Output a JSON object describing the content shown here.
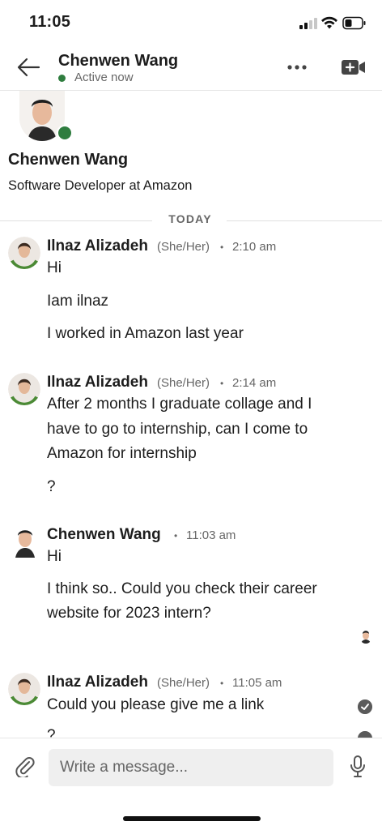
{
  "status_bar": {
    "time": "11:05"
  },
  "header": {
    "name": "Chenwen Wang",
    "presence": "Active now",
    "presence_color": "#2f7d3f"
  },
  "profile": {
    "name": "Chenwen Wang",
    "headline": "Software Developer at Amazon"
  },
  "day_divider": "TODAY",
  "messages": [
    {
      "sender": "Ilnaz Alizadeh",
      "pronouns": "(She/Her)",
      "sep": "•",
      "time": "2:10 am",
      "lines": [
        "Hi",
        "Iam ilnaz",
        "I worked in Amazon last year"
      ]
    },
    {
      "sender": "Ilnaz Alizadeh",
      "pronouns": "(She/Her)",
      "sep": "•",
      "time": "2:14 am",
      "lines": [
        "After 2 months I graduate collage and I",
        "have to go to internship, can I come to",
        "Amazon for internship",
        "?"
      ]
    },
    {
      "sender": "Chenwen Wang",
      "sep": "•",
      "time": "11:03 am",
      "lines": [
        "Hi",
        "I think so.. Could you check their career",
        "website for 2023 intern?"
      ]
    },
    {
      "sender": "Ilnaz Alizadeh",
      "pronouns": "(She/Her)",
      "sep": "•",
      "time": "11:05 am",
      "lines": [
        "Could you please give me a link",
        "?"
      ]
    }
  ],
  "composer": {
    "placeholder": "Write a message..."
  },
  "icons": {
    "back": "arrow-left-icon",
    "more": "more-horizontal-icon",
    "video": "video-call-icon",
    "attach": "paperclip-icon",
    "mic": "microphone-icon",
    "read": "check-circle-icon"
  }
}
